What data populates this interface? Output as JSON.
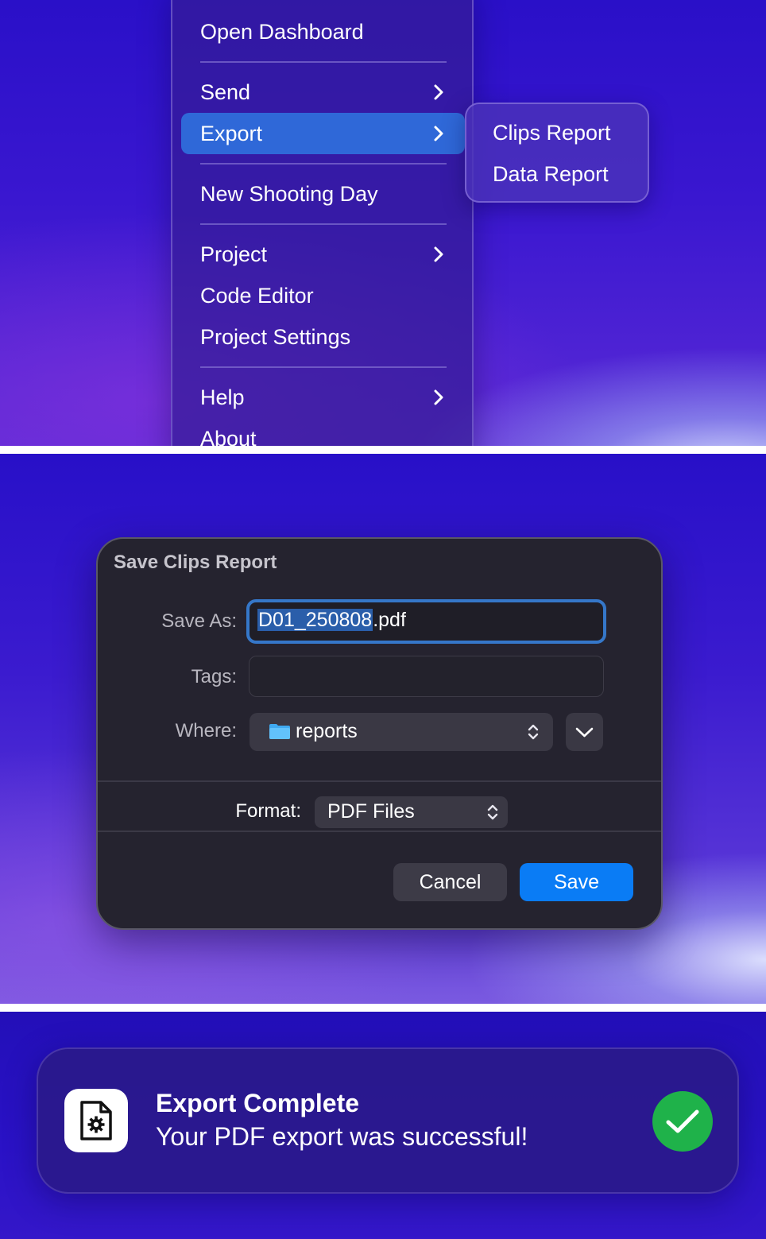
{
  "menu": {
    "items": [
      {
        "label": "Open Dashboard",
        "submenu": false
      },
      {
        "label": "Send",
        "submenu": true
      },
      {
        "label": "Export",
        "submenu": true,
        "active": true
      },
      {
        "label": "New Shooting Day",
        "submenu": false
      },
      {
        "label": "Project",
        "submenu": true
      },
      {
        "label": "Code Editor",
        "submenu": false
      },
      {
        "label": "Project Settings",
        "submenu": false
      },
      {
        "label": "Help",
        "submenu": true
      },
      {
        "label": "About",
        "submenu": false
      }
    ],
    "highlight_color": "#2f68d8"
  },
  "export_submenu": {
    "items": [
      "Clips Report",
      "Data Report"
    ]
  },
  "save_dialog": {
    "title": "Save Clips Report",
    "save_as_label": "Save As:",
    "filename_selected": "D01_250808",
    "filename_ext": ".pdf",
    "tags_label": "Tags:",
    "tags_value": "",
    "where_label": "Where:",
    "where_value": "reports",
    "format_label": "Format:",
    "format_value": "PDF Files",
    "cancel_label": "Cancel",
    "save_label": "Save",
    "accent_color": "#0a7cf5"
  },
  "toast": {
    "title": "Export Complete",
    "message": "Your PDF export was successful!",
    "success_color": "#1fb24a"
  }
}
